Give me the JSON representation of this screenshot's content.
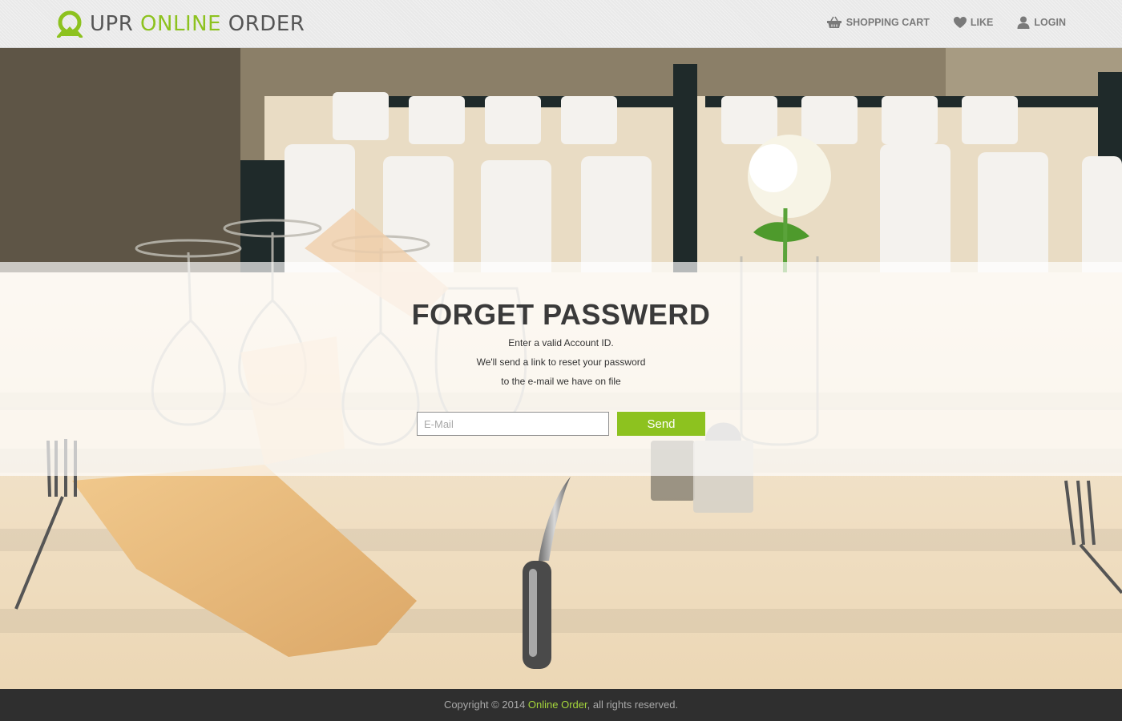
{
  "brand": {
    "logo_word1": "UPR",
    "logo_word2": "ONLINE",
    "logo_word3": "ORDER",
    "accent_color": "#8dc21f"
  },
  "nav": {
    "items": [
      {
        "label": "SHOPPING CART",
        "icon": "basket-icon"
      },
      {
        "label": "LIKE",
        "icon": "heart-icon"
      },
      {
        "label": "LOGIN",
        "icon": "user-icon"
      }
    ]
  },
  "form": {
    "title": "FORGET PASSWERD",
    "lines": [
      "Enter a valid Account ID.",
      "We'll send a link to reset your password",
      "to the e-mail we have on file"
    ],
    "email_placeholder": "E-Mail",
    "email_value": "",
    "send_label": "Send"
  },
  "footer": {
    "prefix": "Copyright © 2014 ",
    "brand": "Online Order",
    "suffix": ", all rights reserved."
  }
}
